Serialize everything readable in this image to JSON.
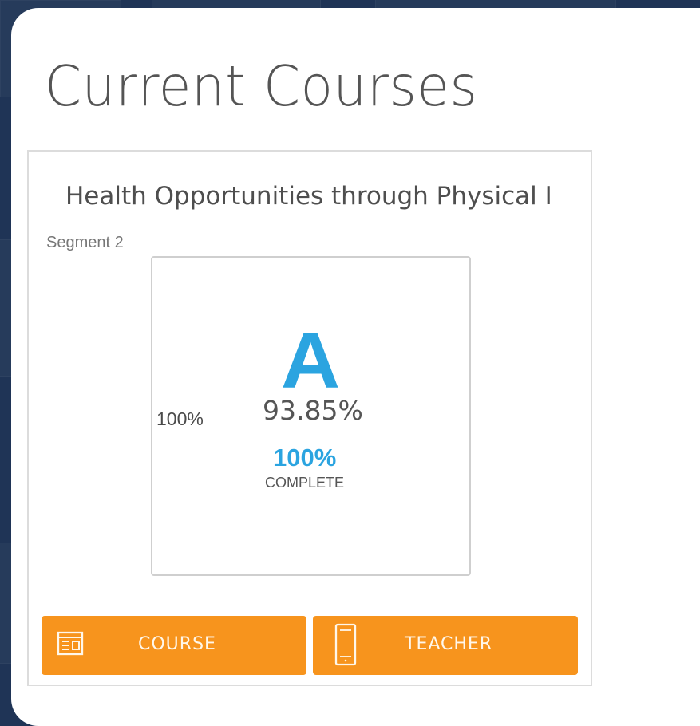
{
  "page": {
    "title": "Current Courses"
  },
  "course": {
    "title": "Health Opportunities through Physical I",
    "segment": "Segment 2",
    "progress": "100%",
    "grade_letter": "A",
    "grade_percent": "93.85%",
    "completion_percent": "100%",
    "completion_label": "COMPLETE"
  },
  "buttons": {
    "course": {
      "label": "COURSE",
      "icon": "browser-window-icon"
    },
    "teacher": {
      "label": "TEACHER",
      "icon": "mobile-phone-icon"
    }
  },
  "colors": {
    "background": "#1f3456",
    "accent_blue": "#2ba4e0",
    "button_orange": "#f7941d"
  }
}
